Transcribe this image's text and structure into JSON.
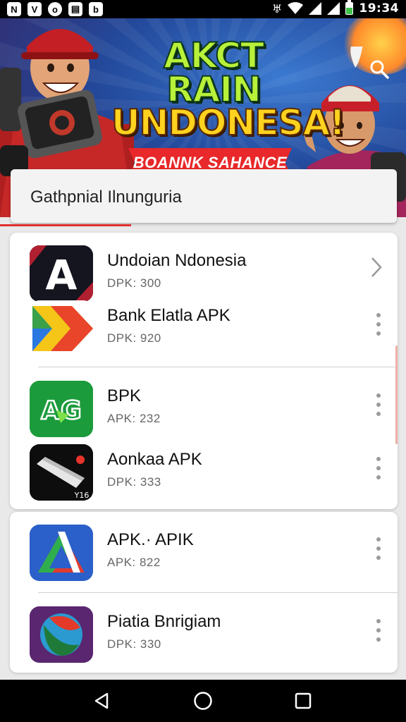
{
  "status_bar": {
    "left_icons": [
      "notification-n-icon",
      "v-app-icon",
      "circle-app-icon",
      "clipboard-icon",
      "b-app-icon"
    ],
    "time": "19:34"
  },
  "banner": {
    "headline_line1": "AKCT RAIN",
    "headline_line2": "UNDONESA!",
    "ribbon": "BOANNK SAHANCE"
  },
  "search": {
    "text": "Gathpnial Ilnunguria"
  },
  "apps": [
    {
      "title": "Undoian Ndonesia",
      "subtitle": "DPK: 300",
      "icon": "a-logo-icon",
      "action": "chevron-right-icon"
    },
    {
      "title": "Bank Elatla APK",
      "subtitle": "DPK: 920",
      "icon": "arrow-logo-icon",
      "action": "more-vert-icon"
    },
    {
      "title": "BPK",
      "subtitle": "APK: 232",
      "icon": "ag-logo-icon",
      "action": "more-vert-icon"
    },
    {
      "title": "Aonkaa APK",
      "subtitle": "DPK: 333",
      "icon": "blade-logo-icon",
      "action": "more-vert-icon"
    },
    {
      "title": "APK.· APIK",
      "subtitle": "APK: 822",
      "icon": "triangle-logo-icon",
      "action": "more-vert-icon"
    },
    {
      "title": "Piatia Bnrigiam",
      "subtitle": "DPK: 330",
      "icon": "planet-logo-icon",
      "action": "more-vert-icon"
    }
  ],
  "icon_badges": {
    "blade": "Y16"
  },
  "icon_labels": {
    "a_logo": "A",
    "ag_logo": "AG"
  },
  "colors": {
    "accent_red": "#e0302f",
    "banner_green": "#b8f03a",
    "banner_yellow": "#ffd21f",
    "status_bar": "#000000",
    "nav_bar": "#000000"
  }
}
